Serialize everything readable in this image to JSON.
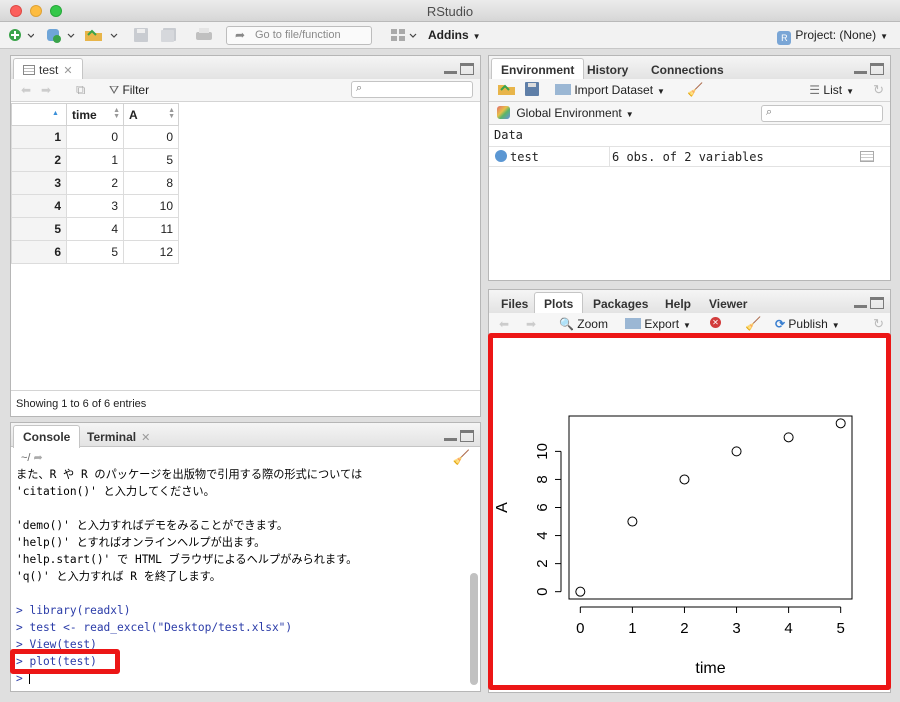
{
  "window": {
    "title": "RStudio"
  },
  "toolbar": {
    "goto_placeholder": "Go to file/function",
    "addins_label": "Addins",
    "project_label": "Project: (None)"
  },
  "source_pane": {
    "tab_label": "test",
    "filter_label": "Filter",
    "columns": [
      "time",
      "A"
    ],
    "rows": [
      {
        "n": "1",
        "time": "0",
        "A": "0"
      },
      {
        "n": "2",
        "time": "1",
        "A": "5"
      },
      {
        "n": "3",
        "time": "2",
        "A": "8"
      },
      {
        "n": "4",
        "time": "3",
        "A": "10"
      },
      {
        "n": "5",
        "time": "4",
        "A": "11"
      },
      {
        "n": "6",
        "time": "5",
        "A": "12"
      }
    ],
    "status": "Showing 1 to 6 of 6 entries"
  },
  "console_pane": {
    "tabs": [
      "Console",
      "Terminal"
    ],
    "path": "~/",
    "lines": [
      {
        "text": "また、R や R のパッケージを出版物で引用する際の形式については",
        "kind": "output"
      },
      {
        "text": "'citation()' と入力してください。",
        "kind": "output"
      },
      {
        "text": "",
        "kind": "output"
      },
      {
        "text": "'demo()' と入力すればデモをみることができます。",
        "kind": "output"
      },
      {
        "text": "'help()' とすればオンラインヘルプが出ます。",
        "kind": "output"
      },
      {
        "text": "'help.start()' で HTML ブラウザによるヘルプがみられます。",
        "kind": "output"
      },
      {
        "text": "'q()' と入力すれば R を終了します。",
        "kind": "output"
      },
      {
        "text": "",
        "kind": "output"
      },
      {
        "text": "> library(readxl)",
        "kind": "cmd"
      },
      {
        "text": "> test <- read_excel(\"Desktop/test.xlsx\")",
        "kind": "cmd"
      },
      {
        "text": "> View(test)",
        "kind": "cmd"
      },
      {
        "text": "> plot(test)",
        "kind": "cmd"
      },
      {
        "text": "> ",
        "kind": "cmd"
      }
    ]
  },
  "env_pane": {
    "tabs": [
      "Environment",
      "History",
      "Connections"
    ],
    "import_label": "Import Dataset",
    "list_label": "List",
    "scope_label": "Global Environment",
    "section_label": "Data",
    "var_name": "test",
    "var_desc": "6 obs. of 2 variables"
  },
  "plots_pane": {
    "tabs": [
      "Files",
      "Plots",
      "Packages",
      "Help",
      "Viewer"
    ],
    "zoom_label": "Zoom",
    "export_label": "Export",
    "publish_label": "Publish"
  },
  "chart_data": {
    "type": "scatter",
    "x": [
      0,
      1,
      2,
      3,
      4,
      5
    ],
    "y": [
      0,
      5,
      8,
      10,
      11,
      12
    ],
    "xlabel": "time",
    "ylabel": "A",
    "xlim": [
      0,
      5
    ],
    "ylim": [
      0,
      12
    ],
    "xticks": [
      "0",
      "1",
      "2",
      "3",
      "4",
      "5"
    ],
    "yticks": [
      "0",
      "2",
      "4",
      "6",
      "8",
      "10"
    ],
    "marker": "open-circle",
    "grid": false
  },
  "colors": {
    "highlight": "#ec1616",
    "command": "#2b3ca8"
  }
}
